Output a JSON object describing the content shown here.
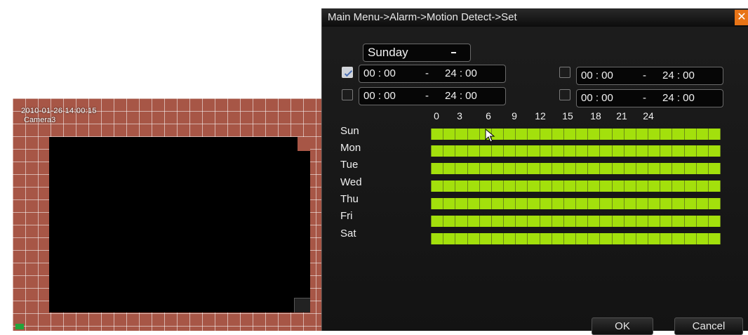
{
  "camera": {
    "timestamp": "2010-01-26 14:00:15",
    "name": "Camera3"
  },
  "dialog": {
    "title": "Main Menu->Alarm->Motion Detect->Set",
    "close_icon": "close-icon",
    "day_select": {
      "value": "Sunday"
    },
    "periods": [
      {
        "enabled": true,
        "start": "00 : 00",
        "sep": "-",
        "end": "24 : 00"
      },
      {
        "enabled": false,
        "start": "00 : 00",
        "sep": "-",
        "end": "24 : 00"
      },
      {
        "enabled": false,
        "start": "00 : 00",
        "sep": "-",
        "end": "24 : 00"
      },
      {
        "enabled": false,
        "start": "00 : 00",
        "sep": "-",
        "end": "24 : 00"
      }
    ],
    "hours": [
      "0",
      "3",
      "6",
      "9",
      "12",
      "15",
      "18",
      "21",
      "24"
    ],
    "days": [
      "Sun",
      "Mon",
      "Tue",
      "Wed",
      "Thu",
      "Fri",
      "Sat"
    ],
    "ok_label": "OK",
    "cancel_label": "Cancel"
  },
  "colors": {
    "grid_active": "#a3e00c",
    "motion_grid": "#a75646",
    "close_button": "#e87417"
  }
}
